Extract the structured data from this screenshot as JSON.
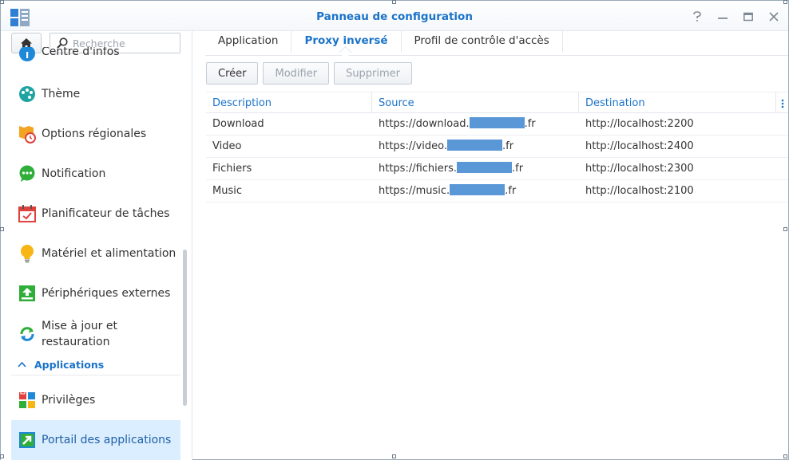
{
  "window": {
    "title": "Panneau de configuration",
    "accent_color": "#1a73c9",
    "controls": [
      "help-icon",
      "minimize-icon",
      "maximize-icon",
      "close-icon"
    ]
  },
  "sidebar": {
    "search_placeholder": "Recherche",
    "items": [
      {
        "label": "Centre d'infos",
        "icon": "info-icon"
      },
      {
        "label": "Thème",
        "icon": "palette-icon"
      },
      {
        "label": "Options régionales",
        "icon": "regional-clock-icon"
      },
      {
        "label": "Notification",
        "icon": "chat-bubble-icon"
      },
      {
        "label": "Planificateur de tâches",
        "icon": "calendar-check-icon"
      },
      {
        "label": "Matériel et alimentation",
        "icon": "lightbulb-icon"
      },
      {
        "label": "Périphériques externes",
        "icon": "upload-device-icon"
      },
      {
        "label": "Mise à jour et restauration",
        "icon": "refresh-icon"
      }
    ],
    "section": "Applications",
    "app_items": [
      {
        "label": "Privilèges",
        "icon": "privileges-icon"
      },
      {
        "label": "Portail des applications",
        "icon": "portal-arrow-icon",
        "active": true
      }
    ]
  },
  "tabs": [
    {
      "label": "Application"
    },
    {
      "label": "Proxy inversé",
      "active": true
    },
    {
      "label": "Profil de contrôle d'accès"
    }
  ],
  "toolbar": {
    "create": "Créer",
    "edit": "Modifier",
    "delete": "Supprimer"
  },
  "table": {
    "columns": [
      "Description",
      "Source",
      "Destination"
    ],
    "rows": [
      {
        "description": "Download",
        "source_prefix": "https://download.",
        "source_suffix": ".fr",
        "destination": "http://localhost:2200"
      },
      {
        "description": "Video",
        "source_prefix": "https://video.",
        "source_suffix": ".fr",
        "destination": "http://localhost:2400"
      },
      {
        "description": "Fichiers",
        "source_prefix": "https://fichiers.",
        "source_suffix": ".fr",
        "destination": "http://localhost:2300"
      },
      {
        "description": "Music",
        "source_prefix": "https://music.",
        "source_suffix": ".fr",
        "destination": "http://localhost:2100"
      }
    ]
  }
}
